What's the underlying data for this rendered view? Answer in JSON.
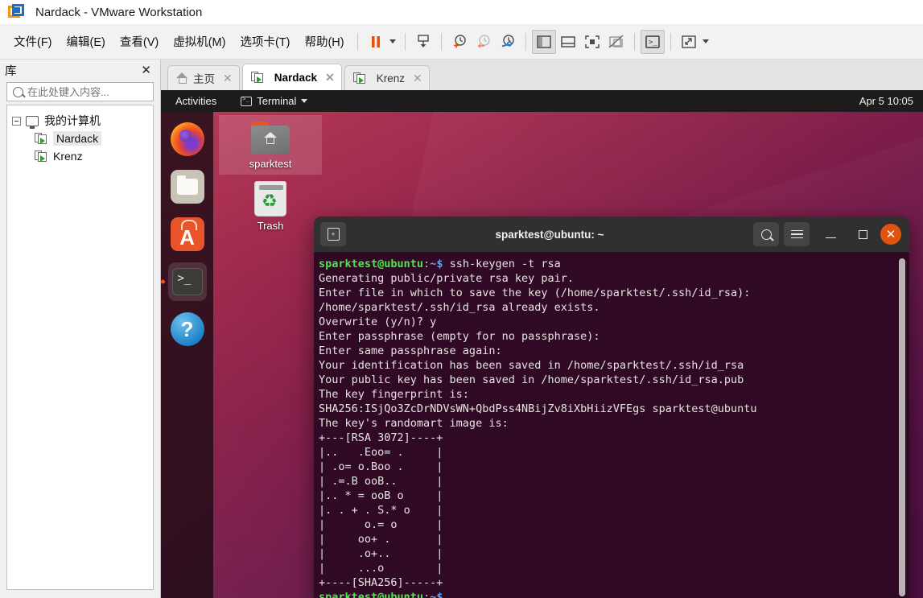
{
  "window": {
    "title": "Nardack - VMware Workstation",
    "logo_icon": "vmware-logo-icon"
  },
  "menubar": {
    "items": [
      {
        "label": "文件(F)",
        "name": "menu-file"
      },
      {
        "label": "编辑(E)",
        "name": "menu-edit"
      },
      {
        "label": "查看(V)",
        "name": "menu-view"
      },
      {
        "label": "虚拟机(M)",
        "name": "menu-vm"
      },
      {
        "label": "选项卡(T)",
        "name": "menu-tabs"
      },
      {
        "label": "帮助(H)",
        "name": "menu-help"
      }
    ],
    "toolbar_icons": [
      "suspend-icon",
      "suspend-dropdown-caret",
      "power-on-guest-icon",
      "snapshot-take-icon",
      "snapshot-revert-icon",
      "snapshot-manager-icon",
      "show-library-icon",
      "show-thumbnail-bar-icon",
      "fullscreen-icon",
      "unity-mode-icon",
      "console-view-icon",
      "stretch-guest-icon",
      "stretch-dropdown-caret"
    ]
  },
  "library": {
    "title": "库",
    "close_label": "✕",
    "search_placeholder": "在此处键入内容...",
    "search_value": "",
    "tree": [
      {
        "label": "我的计算机",
        "icon": "monitor-icon",
        "level": 0,
        "selected": false
      },
      {
        "label": "Nardack",
        "icon": "vm-icon",
        "level": 1,
        "selected": true
      },
      {
        "label": "Krenz",
        "icon": "vm-icon",
        "level": 1,
        "selected": false
      }
    ]
  },
  "tabs": [
    {
      "label": "主页",
      "icon": "home-icon",
      "active": false,
      "close": "✕"
    },
    {
      "label": "Nardack",
      "icon": "vm-icon",
      "active": true,
      "close": "✕"
    },
    {
      "label": "Krenz",
      "icon": "vm-icon",
      "active": false,
      "close": "✕"
    }
  ],
  "guest": {
    "topbar": {
      "activities": "Activities",
      "app_name": "Terminal",
      "app_icon": "terminal-icon",
      "clock": "Apr 5  10:05"
    },
    "dock": [
      {
        "name": "firefox",
        "label": "Firefox Web Browser",
        "running": false
      },
      {
        "name": "files",
        "label": "Files",
        "running": false
      },
      {
        "name": "software",
        "label": "Ubuntu Software",
        "running": false
      },
      {
        "name": "terminal",
        "label": "Terminal",
        "running": true
      },
      {
        "name": "help",
        "label": "Help",
        "running": false
      }
    ],
    "desktop_icons": [
      {
        "label": "sparktest",
        "icon": "home-folder-icon",
        "selected": true
      },
      {
        "label": "Trash",
        "icon": "trash-icon",
        "selected": false
      }
    ],
    "terminal": {
      "title": "sparktest@ubuntu: ~",
      "buttons": {
        "new_tab": "new-tab-icon",
        "search": "search-icon",
        "menu": "hamburger-menu-icon",
        "minimize": "minimize-icon",
        "maximize": "maximize-icon",
        "close": "✕"
      },
      "prompt_user": "sparktest@ubuntu",
      "prompt_colon": ":",
      "prompt_path": "~$",
      "command": " ssh-keygen -t rsa",
      "output": "Generating public/private rsa key pair.\nEnter file in which to save the key (/home/sparktest/.ssh/id_rsa): \n/home/sparktest/.ssh/id_rsa already exists.\nOverwrite (y/n)? y\nEnter passphrase (empty for no passphrase): \nEnter same passphrase again: \nYour identification has been saved in /home/sparktest/.ssh/id_rsa\nYour public key has been saved in /home/sparktest/.ssh/id_rsa.pub\nThe key fingerprint is:\nSHA256:ISjQo3ZcDrNDVsWN+QbdPss4NBijZv8iXbHiizVFEgs sparktest@ubuntu\nThe key's randomart image is:\n+---[RSA 3072]----+\n|..   .Eoo= .     |\n| .o= o.Boo .     |\n| .=.B ooB..      |\n|.. * = ooB o     |\n|. . + . S.* o    |\n|      o.= o      |\n|     oo+ .       |\n|     .o+..       |\n|     ...o        |\n+----[SHA256]-----+",
      "prompt2_user": "sparktest@ubuntu",
      "prompt2_colon": ":",
      "prompt2_path": "~$"
    }
  },
  "colors": {
    "ubuntu_orange": "#e2530f",
    "terminal_bg": "#300a24",
    "prompt_green": "#4ee44e",
    "prompt_blue": "#6b9fe8",
    "vmware_blue": "#1c6fc9",
    "vmware_orange": "#f2960d"
  }
}
